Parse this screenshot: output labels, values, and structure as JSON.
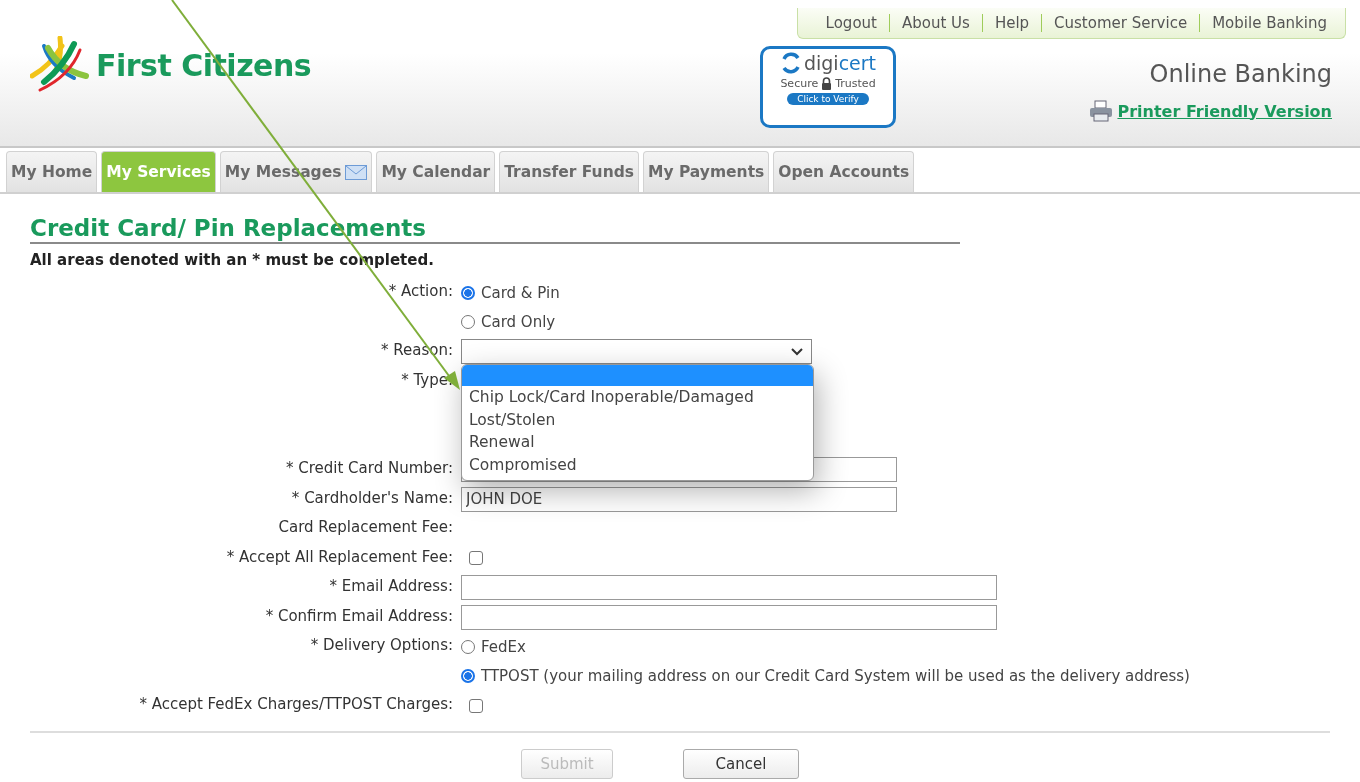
{
  "top_links": [
    "Logout",
    "About Us",
    "Help",
    "Customer Service",
    "Mobile Banking"
  ],
  "header": {
    "brand": "First Citizens",
    "badge": {
      "name_left": "digi",
      "name_right": "cert",
      "secure": "Secure",
      "trusted": "Trusted",
      "verify": "Click to Verify"
    },
    "title": "Online Banking",
    "printer_link": "Printer Friendly Version"
  },
  "tabs": [
    {
      "label": "My Home",
      "selected": false,
      "kind": "plain"
    },
    {
      "label": "My Services",
      "selected": true,
      "kind": "plain"
    },
    {
      "label": "My Messages",
      "selected": false,
      "kind": "mail"
    },
    {
      "label": "My Calendar",
      "selected": false,
      "kind": "plain"
    },
    {
      "label": "Transfer Funds",
      "selected": false,
      "kind": "plain"
    },
    {
      "label": "My Payments",
      "selected": false,
      "kind": "plain"
    },
    {
      "label": "Open Accounts",
      "selected": false,
      "kind": "plain"
    }
  ],
  "page": {
    "title": "Credit Card/ Pin Replacements",
    "note": "All areas denoted with an * must be completed."
  },
  "form": [
    {
      "kind": "radio",
      "label": "* Action:",
      "options": [
        {
          "label": "Card & Pin",
          "selected": true
        },
        {
          "label": "Card Only",
          "selected": false
        }
      ]
    },
    {
      "kind": "select",
      "label": "* Reason:",
      "dropdown": {
        "open": true,
        "blank_option_highlighted": true,
        "options": [
          "Chip Lock/Card Inoperable/Damaged",
          "Lost/Stolen",
          "Renewal",
          "Compromised"
        ]
      }
    },
    {
      "kind": "covered",
      "label": "* Type:"
    },
    {
      "kind": "text",
      "label": "* Credit Card Number:",
      "wide": false
    },
    {
      "kind": "text",
      "label": "* Cardholder's Name:",
      "wide": false,
      "value": "JOHN DOE"
    },
    {
      "kind": "static",
      "label": "Card Replacement Fee:"
    },
    {
      "kind": "checkbox",
      "label": "* Accept All Replacement Fee:",
      "checked": false
    },
    {
      "kind": "text",
      "label": "* Email Address:",
      "wide": true
    },
    {
      "kind": "text",
      "label": "* Confirm Email Address:",
      "wide": true
    },
    {
      "kind": "radio",
      "label": "* Delivery Options:",
      "options": [
        {
          "label": "FedEx",
          "selected": false
        },
        {
          "label": "TTPOST (your mailing address on our Credit Card System will be used as the delivery address)",
          "selected": true
        }
      ]
    },
    {
      "kind": "checkbox",
      "label": "* Accept FedEx Charges/TTPOST Charges:",
      "checked": false
    }
  ],
  "buttons": [
    {
      "label": "Submit",
      "disabled": true
    },
    {
      "label": "Cancel",
      "disabled": false
    }
  ],
  "annotation": {
    "kind": "arrow"
  }
}
